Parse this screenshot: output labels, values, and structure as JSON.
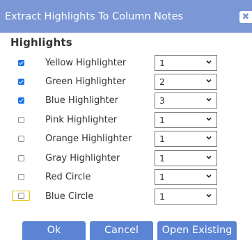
{
  "dialog": {
    "title": "Extract Highlights To Column Notes",
    "close_glyph": "✖"
  },
  "section": {
    "title": "Highlights"
  },
  "rows": [
    {
      "label": "Yellow Highlighter",
      "checked": true,
      "value": "1"
    },
    {
      "label": "Green Highlighter",
      "checked": true,
      "value": "2"
    },
    {
      "label": "Blue Highlighter",
      "checked": true,
      "value": "3"
    },
    {
      "label": "Pink Highlighter",
      "checked": false,
      "value": "1"
    },
    {
      "label": "Orange Highlighter",
      "checked": false,
      "value": "1"
    },
    {
      "label": "Gray Highlighter",
      "checked": false,
      "value": "1"
    },
    {
      "label": "Red Circle",
      "checked": false,
      "value": "1"
    },
    {
      "label": "Blue Circle",
      "checked": false,
      "value": "1",
      "focused": true
    }
  ],
  "buttons": {
    "ok": "Ok",
    "cancel": "Cancel",
    "open_existing": "Open Existing"
  },
  "colors": {
    "titlebar": "#7b97d6",
    "button": "#5b84d4",
    "checkbox_checked": "#1a73e8",
    "focus_outline": "#e6c100"
  },
  "icons": {
    "close": "close-icon",
    "checkbox": "checkbox-icon",
    "dropdown": "chevron-down-icon"
  }
}
